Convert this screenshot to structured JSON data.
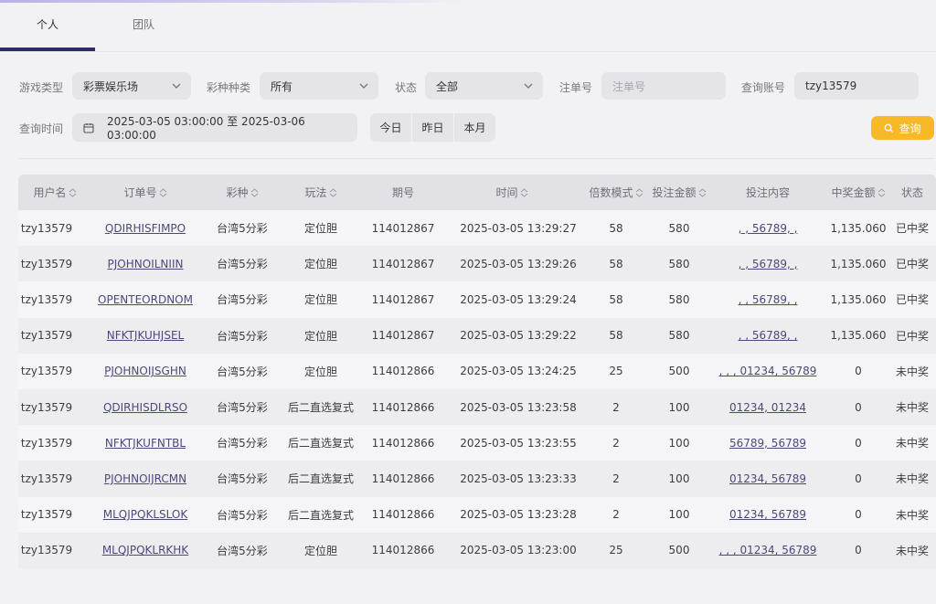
{
  "tabs": [
    {
      "label": "个人",
      "active": true
    },
    {
      "label": "团队",
      "active": false
    }
  ],
  "filters": {
    "game_type_label": "游戏类型",
    "game_type_value": "彩票娱乐场",
    "lottery_type_label": "彩种种类",
    "lottery_type_value": "所有",
    "status_label": "状态",
    "status_value": "全部",
    "order_no_label": "注单号",
    "order_no_placeholder": "注单号",
    "account_label": "查询账号",
    "account_value": "tzy13579",
    "time_label": "查询时间",
    "date_range": "2025-03-05 03:00:00 至 2025-03-06 03:00:00",
    "quick": [
      "今日",
      "昨日",
      "本月"
    ],
    "query_button": "查询"
  },
  "table": {
    "headers": [
      "用户名",
      "订单号",
      "彩种",
      "玩法",
      "期号",
      "时间",
      "倍数模式",
      "投注金额",
      "投注内容",
      "中奖金额",
      "状态"
    ],
    "rows": [
      {
        "user": "tzy13579",
        "order": "QDIRHISFIMPO",
        "lottery": "台湾5分彩",
        "play": "定位胆",
        "issue": "114012867",
        "time": "2025-03-05 13:29:27",
        "multiple": "58",
        "amount": "580",
        "content": ", , 56789, ,",
        "win": "1,135.060",
        "status": "已中奖"
      },
      {
        "user": "tzy13579",
        "order": "PJOHNOILNIIN",
        "lottery": "台湾5分彩",
        "play": "定位胆",
        "issue": "114012867",
        "time": "2025-03-05 13:29:26",
        "multiple": "58",
        "amount": "580",
        "content": ", , 56789, ,",
        "win": "1,135.060",
        "status": "已中奖"
      },
      {
        "user": "tzy13579",
        "order": "OPENTEORDNOM",
        "lottery": "台湾5分彩",
        "play": "定位胆",
        "issue": "114012867",
        "time": "2025-03-05 13:29:24",
        "multiple": "58",
        "amount": "580",
        "content": ", , 56789, ,",
        "win": "1,135.060",
        "status": "已中奖"
      },
      {
        "user": "tzy13579",
        "order": "NFKTJKUHJSEL",
        "lottery": "台湾5分彩",
        "play": "定位胆",
        "issue": "114012867",
        "time": "2025-03-05 13:29:22",
        "multiple": "58",
        "amount": "580",
        "content": ", , 56789, ,",
        "win": "1,135.060",
        "status": "已中奖"
      },
      {
        "user": "tzy13579",
        "order": "PJOHNOIJSGHN",
        "lottery": "台湾5分彩",
        "play": "定位胆",
        "issue": "114012866",
        "time": "2025-03-05 13:24:25",
        "multiple": "25",
        "amount": "500",
        "content": ", , , 01234, 56789",
        "win": "0",
        "status": "未中奖"
      },
      {
        "user": "tzy13579",
        "order": "QDIRHISDLRSO",
        "lottery": "台湾5分彩",
        "play": "后二直选复式",
        "issue": "114012866",
        "time": "2025-03-05 13:23:58",
        "multiple": "2",
        "amount": "100",
        "content": "01234, 01234",
        "win": "0",
        "status": "未中奖"
      },
      {
        "user": "tzy13579",
        "order": "NFKTJKUFNTBL",
        "lottery": "台湾5分彩",
        "play": "后二直选复式",
        "issue": "114012866",
        "time": "2025-03-05 13:23:55",
        "multiple": "2",
        "amount": "100",
        "content": "56789, 56789",
        "win": "0",
        "status": "未中奖"
      },
      {
        "user": "tzy13579",
        "order": "PJOHNOIJRCMN",
        "lottery": "台湾5分彩",
        "play": "后二直选复式",
        "issue": "114012866",
        "time": "2025-03-05 13:23:33",
        "multiple": "2",
        "amount": "100",
        "content": "01234, 56789",
        "win": "0",
        "status": "未中奖"
      },
      {
        "user": "tzy13579",
        "order": "MLQJPQKLSLOK",
        "lottery": "台湾5分彩",
        "play": "后二直选复式",
        "issue": "114012866",
        "time": "2025-03-05 13:23:28",
        "multiple": "2",
        "amount": "100",
        "content": "01234, 56789",
        "win": "0",
        "status": "未中奖"
      },
      {
        "user": "tzy13579",
        "order": "MLQJPQKLRKHK",
        "lottery": "台湾5分彩",
        "play": "定位胆",
        "issue": "114012866",
        "time": "2025-03-05 13:23:00",
        "multiple": "25",
        "amount": "500",
        "content": ", , , 01234, 56789",
        "win": "0",
        "status": "未中奖"
      }
    ]
  },
  "colors": {
    "accent": "#2c2a6b",
    "query_button": "#f7b927"
  }
}
